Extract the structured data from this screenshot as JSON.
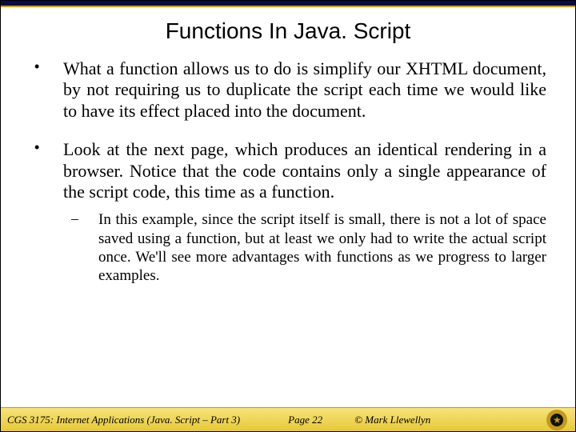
{
  "title": "Functions In Java. Script",
  "bullets": [
    "What a function allows us to do is simplify our XHTML document, by not requiring us to duplicate the script each time we would like to have its effect placed into the document.",
    "Look at the next page, which produces an identical rendering in a browser.  Notice that the code contains only a single appearance of the script code, this time as a function."
  ],
  "sub_bullet": "In this example, since the script itself is small, there is not a lot of space saved using a function, but at least we only had to write the actual script once.  We'll see more advantages with functions as we progress to larger examples.",
  "footer": {
    "course": "CGS 3175: Internet Applications (Java. Script – Part 3)",
    "page": "Page 22",
    "copyright": "© Mark Llewellyn"
  }
}
